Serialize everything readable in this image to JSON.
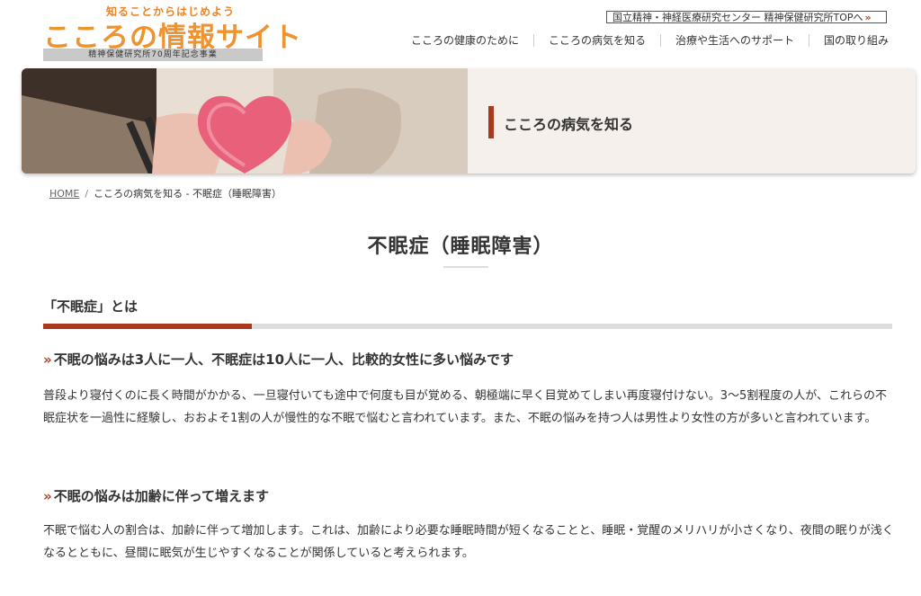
{
  "header": {
    "logo_tagline": "知ることからはじめよう",
    "logo_brand": "こころの情報サイト",
    "logo_sub": "精神保健研究所70周年記念事業",
    "top_link": "国立精神・神経医療研究センター 精神保健研究所TOPへ",
    "top_link_arrow": "»"
  },
  "nav": {
    "items": [
      {
        "label": "こころの健康のために"
      },
      {
        "label": "こころの病気を知る"
      },
      {
        "label": "治療や生活へのサポート"
      },
      {
        "label": "国の取り組み"
      }
    ]
  },
  "hero": {
    "title": "こころの病気を知る"
  },
  "breadcrumb": {
    "home": "HOME",
    "separator": "/",
    "current": "こころの病気を知る - 不眠症（睡眠障害）"
  },
  "page": {
    "title": "不眠症（睡眠障害）"
  },
  "section": {
    "heading": "「不眠症」とは",
    "chevron": "»",
    "sub1_heading": "不眠の悩みは3人に一人、不眠症は10人に一人、比較的女性に多い悩みです",
    "sub1_text": "普段より寝付くのに長く時間がかかる、一旦寝付いても途中で何度も目が覚める、朝極端に早く目覚めてしまい再度寝付けない。3〜5割程度の人が、これらの不眠症状を一過性に経験し、おおよそ1割の人が慢性的な不眠で悩むと言われています。また、不眠の悩みを持つ人は男性より女性の方が多いと言われています。",
    "sub2_heading": "不眠の悩みは加齢に伴って増えます",
    "sub2_text": "不眠で悩む人の割合は、加齢に伴って増加します。これは、加齢により必要な睡眠時間が短くなることと、睡眠・覚醒のメリハリが小さくなり、夜間の眠りが浅くなるとともに、昼間に眠気が生じやすくなることが関係していると考えられます。"
  },
  "colors": {
    "accent": "#a9381c",
    "brand": "#ef9331"
  }
}
